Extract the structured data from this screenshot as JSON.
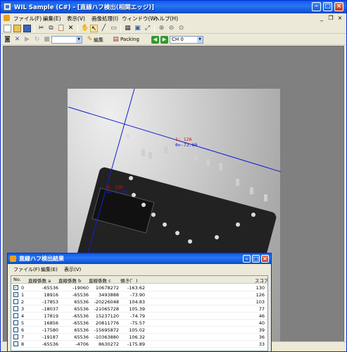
{
  "window": {
    "title": "WIL Sample (C#) - [直線ハフ検出(相関エッジ)]"
  },
  "menu": [
    "ファイル(F)",
    "編集(E)",
    "表示(V)",
    "画像処理(I)",
    "ウィンドウ(W)",
    "ヘルプ(H)"
  ],
  "toolbar2": {
    "combo_value": "",
    "edit_label": "編集",
    "packing_label": "Packing",
    "channel_value": "CH 0"
  },
  "overlay": {
    "label1_index": "1: 126",
    "label1_theta": "θ=-73.00",
    "label0_index": "0: 130",
    "label0_theta": "θ=-16.61",
    "line_color": "#1020d0"
  },
  "result_window": {
    "title": "直線ハフ検出結果",
    "menu": [
      "ファイル(F)",
      "編集(E)",
      "表示(V)"
    ],
    "columns": [
      "No.",
      "直線係数 a",
      "直線係数 b",
      "直線係数 c",
      "傾き(゜)",
      "スコア"
    ],
    "rows": [
      {
        "checked": true,
        "no": "0",
        "a": "-65536",
        "b": "-19060",
        "c": "10678272",
        "slope": "-163.62",
        "score": "130"
      },
      {
        "checked": true,
        "no": "1",
        "a": "18916",
        "b": "-65536",
        "c": "3493888",
        "slope": "-73.90",
        "score": "126"
      },
      {
        "checked": false,
        "no": "2",
        "a": "-17853",
        "b": "65536",
        "c": "-20226048",
        "slope": "104.83",
        "score": "103"
      },
      {
        "checked": false,
        "no": "3",
        "a": "-18037",
        "b": "65536",
        "c": "-21065728",
        "slope": "105.39",
        "score": "77"
      },
      {
        "checked": false,
        "no": "4",
        "a": "17819",
        "b": "-65536",
        "c": "15237120",
        "slope": "-74.79",
        "score": "46"
      },
      {
        "checked": false,
        "no": "5",
        "a": "16856",
        "b": "-65536",
        "c": "20811776",
        "slope": "-75.57",
        "score": "40"
      },
      {
        "checked": false,
        "no": "6",
        "a": "-17580",
        "b": "65536",
        "c": "-15695872",
        "slope": "105.02",
        "score": "39"
      },
      {
        "checked": false,
        "no": "7",
        "a": "-19187",
        "b": "65536",
        "c": "-10363880",
        "slope": "106.32",
        "score": "36"
      },
      {
        "checked": false,
        "no": "8",
        "a": "-65536",
        "b": "-4706",
        "c": "8630272",
        "slope": "-175.89",
        "score": "33"
      }
    ]
  }
}
